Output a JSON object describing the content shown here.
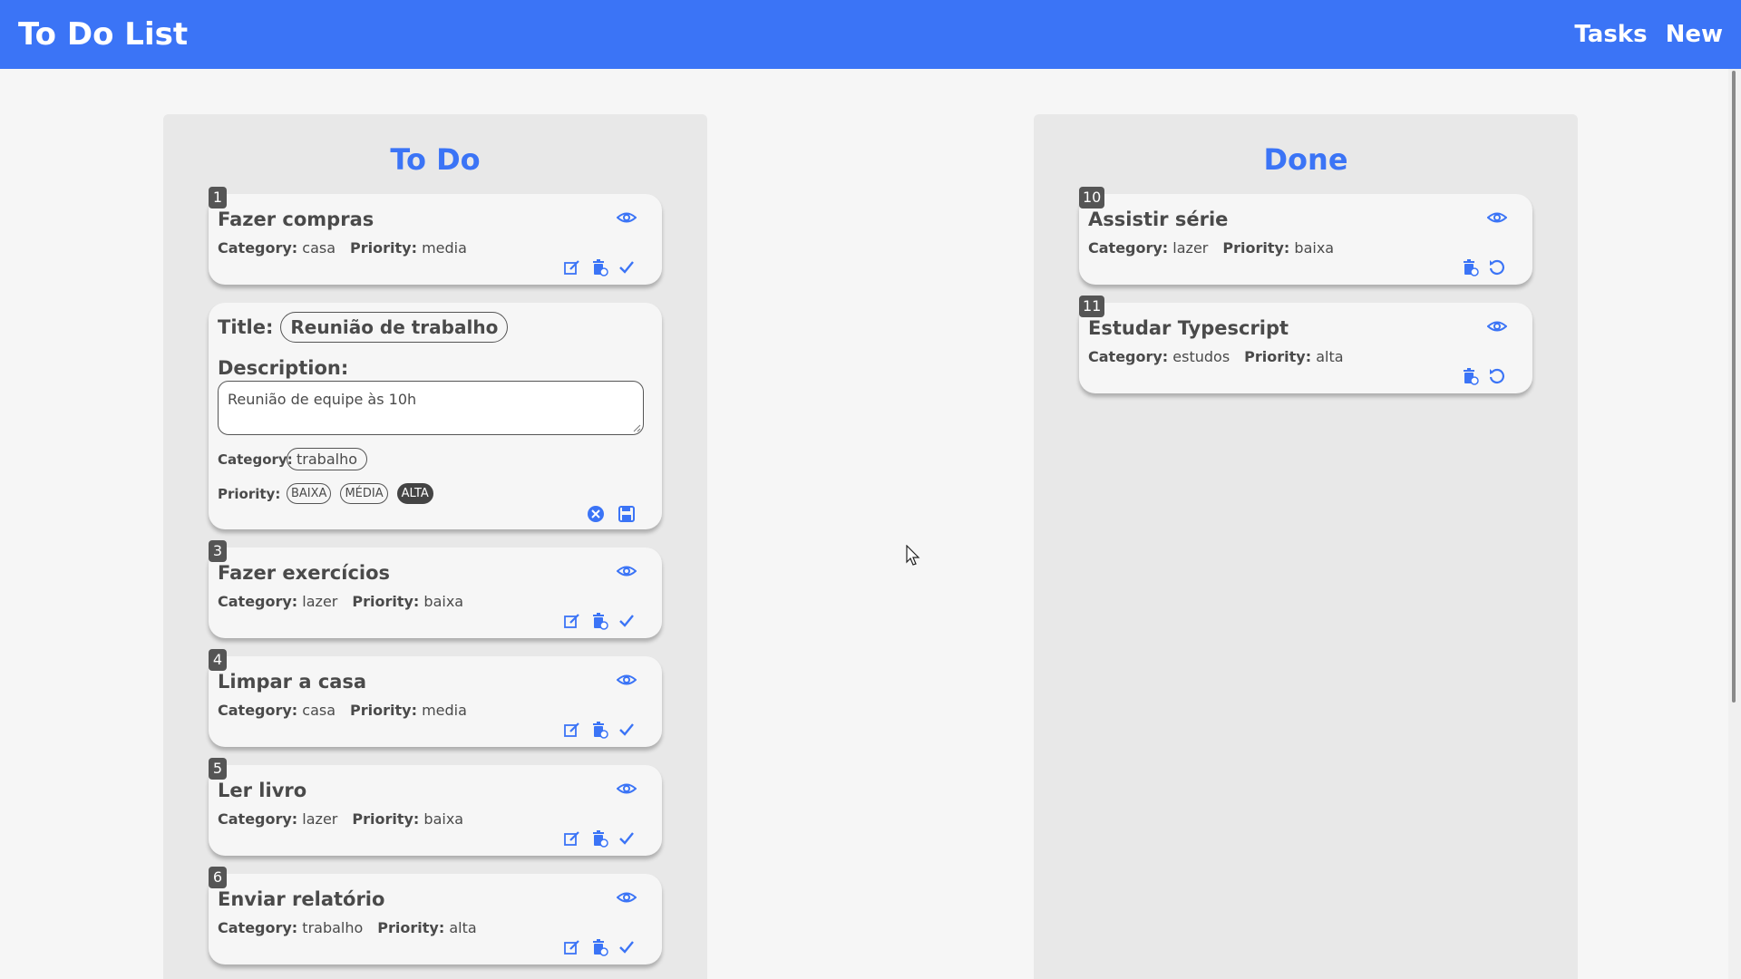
{
  "app": {
    "title": "To Do List"
  },
  "nav": {
    "tasks": "Tasks",
    "new": "New"
  },
  "todo": {
    "heading": "To Do",
    "cards": [
      {
        "id": "1",
        "title": "Fazer compras",
        "category": "casa",
        "priority": "media"
      },
      {
        "id": "3",
        "title": "Fazer exercícios",
        "category": "lazer",
        "priority": "baixa"
      },
      {
        "id": "4",
        "title": "Limpar a casa",
        "category": "casa",
        "priority": "media"
      },
      {
        "id": "5",
        "title": "Ler livro",
        "category": "lazer",
        "priority": "baixa"
      },
      {
        "id": "6",
        "title": "Enviar relatório",
        "category": "trabalho",
        "priority": "alta"
      }
    ]
  },
  "edit": {
    "title_label": "Title:",
    "title_value": "Reunião de trabalho",
    "description_label": "Description:",
    "description_value": "Reunião de equipe às 10h",
    "category_label": "Category:",
    "category_value": "trabalho",
    "priority_label": "Priority:",
    "priority_options": [
      "BAIXA",
      "MÉDIA",
      "ALTA"
    ],
    "priority_selected": "ALTA"
  },
  "done": {
    "heading": "Done",
    "cards": [
      {
        "id": "10",
        "title": "Assistir série",
        "category": "lazer",
        "priority": "baixa"
      },
      {
        "id": "11",
        "title": "Estudar Typescript",
        "category": "estudos",
        "priority": "alta"
      }
    ]
  },
  "labels": {
    "category": "Category:",
    "priority": "Priority:"
  },
  "colors": {
    "accent": "#3b74f6",
    "badge": "#555555",
    "column": "#e8e8e8"
  }
}
